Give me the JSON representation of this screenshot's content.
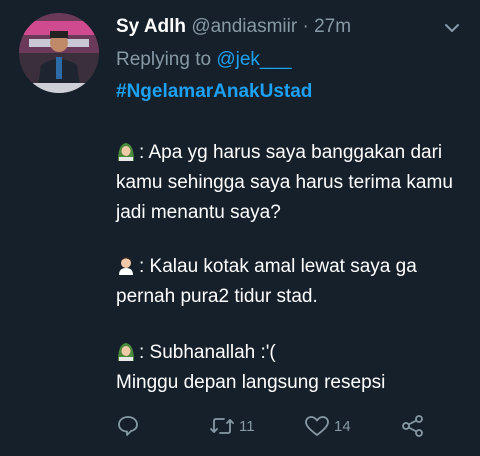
{
  "tweet": {
    "display_name": "Sy Adlh",
    "handle": "@andiasmiir",
    "separator": " · ",
    "time": "27m",
    "replying_to_prefix": "Replying to ",
    "replying_to_handle": "@jek___",
    "hashtag": "#NgelamarAnakUstad",
    "lines": [
      {
        "speaker_icon": "hijab-woman-emoji",
        "text": ": Apa yg harus saya banggakan dari kamu sehingga saya harus terima kamu jadi menantu saya?"
      },
      {
        "speaker_icon": "man-emoji",
        "text": ": Kalau kotak amal lewat saya ga pernah pura2 tidur stad."
      },
      {
        "speaker_icon": "hijab-woman-emoji",
        "text": ": Subhanallah :'("
      },
      {
        "speaker_icon": "",
        "text": "Minggu depan langsung resepsi"
      }
    ],
    "actions": {
      "reply_count": "",
      "retweet_count": "11",
      "like_count": "14"
    }
  },
  "colors": {
    "background": "#15202b",
    "muted": "#8899a6",
    "accent": "#1da1f2",
    "text": "#ffffff"
  }
}
